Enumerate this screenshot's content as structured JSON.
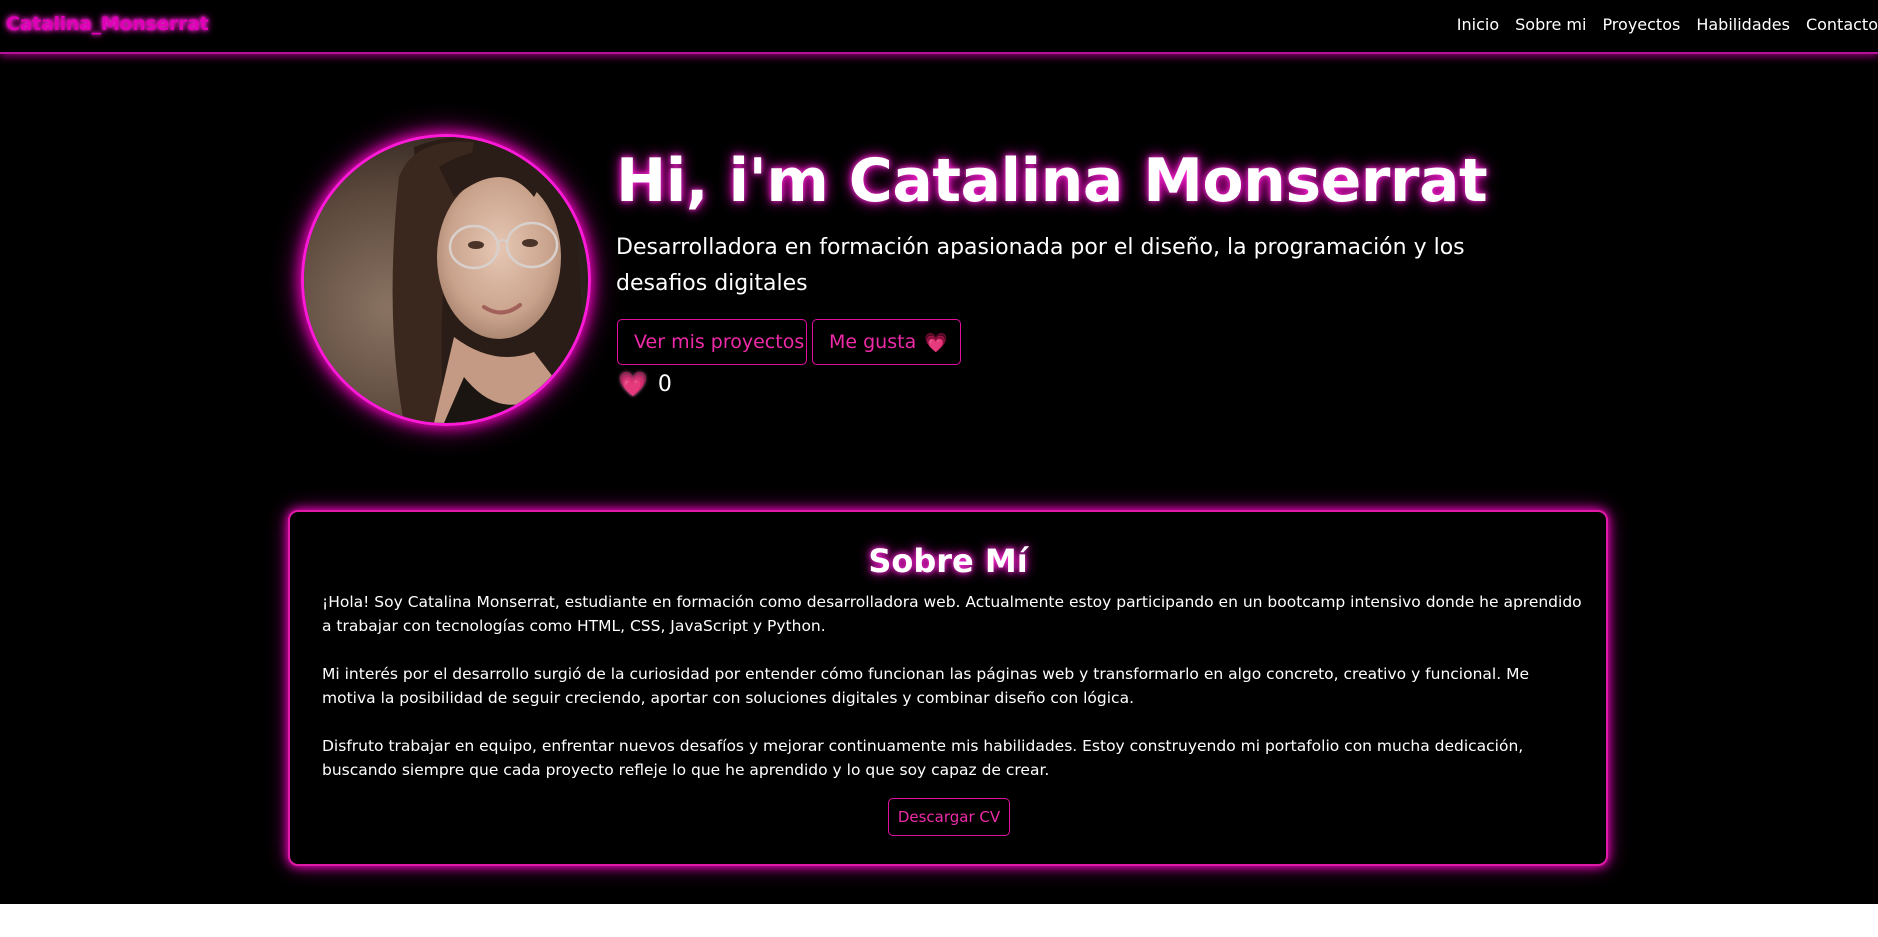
{
  "navbar": {
    "brand": "Catalina_Monserrat",
    "links": [
      "Inicio",
      "Sobre mi",
      "Proyectos",
      "Habilidades",
      "Contacto"
    ]
  },
  "hero": {
    "title": "Hi, i'm Catalina Monserrat",
    "subtitle": "Desarrolladora en formación apasionada por el diseño, la programación y los desafios digitales",
    "projects_button": "Ver mis proyectos",
    "like_button": "Me gusta",
    "like_icon": "💗",
    "like_count": "0"
  },
  "about": {
    "title": "Sobre Mí",
    "paragraphs": [
      "¡Hola! Soy Catalina Monserrat, estudiante en formación como desarrolladora web. Actualmente estoy participando en un bootcamp intensivo donde he aprendido a trabajar con tecnologías como HTML, CSS, JavaScript y Python.",
      "Mi interés por el desarrollo surgió de la curiosidad por entender cómo funcionan las páginas web y transformarlo en algo concreto, creativo y funcional. Me motiva la posibilidad de seguir creciendo, aportar con soluciones digitales y combinar diseño con lógica.",
      "Disfruto trabajar en equipo, enfrentar nuevos desafíos y mejorar continuamente mis habilidades. Estoy construyendo mi portafolio con mucha dedicación, buscando siempre que cada proyecto refleje lo que he aprendido y lo que soy capaz de crear."
    ],
    "cv_button": "Descargar CV"
  },
  "colors": {
    "background": "#000000",
    "accent": "#ff00cc",
    "button_text": "#ee2aa8",
    "text": "#ffffff"
  },
  "icons": {
    "heart": "heart-icon"
  }
}
